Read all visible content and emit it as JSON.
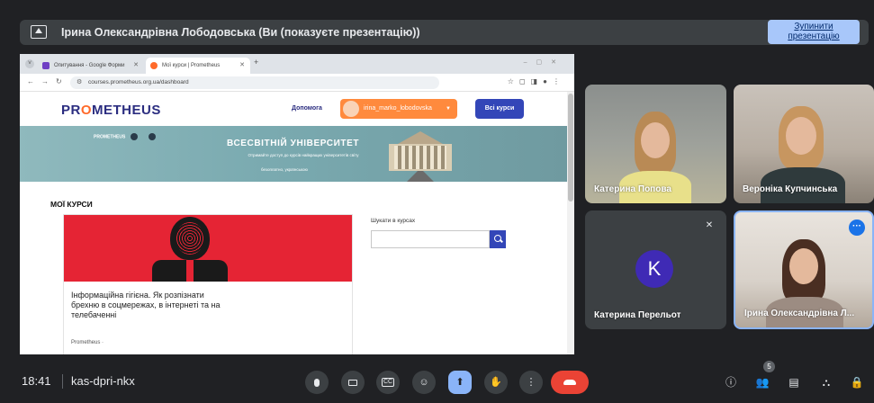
{
  "presenting": {
    "title": "Ірина Олександрівна Лободовська (Ви (показуєте презентацію))",
    "stop_label": "Зупинити презентацію"
  },
  "browser": {
    "tabs": [
      {
        "label": "Опитування - Google Форми"
      },
      {
        "label": "Мої курси | Prometheus"
      }
    ],
    "url": "courses.prometheus.org.ua/dashboard"
  },
  "site": {
    "logo_pre": "PR",
    "logo_o": "O",
    "logo_post": "METHEUS",
    "help": "Допомога",
    "user": "irina_marko_lobodovska",
    "all_courses": "Всі курси",
    "banner_logos": "PROMETHEUS",
    "banner_title": "ВСЕСВІТНІЙ УНІВЕРСИТЕТ",
    "banner_sub": "Отримайте доступ до курсів найкращих університетів світу",
    "banner_small": "безоплатно, українською",
    "my_courses": "МОЇ КУРСИ",
    "course_title": "Інформаційна гігієна. Як розпізнати брехню в соцмережах, в інтернеті та на телебаченні",
    "course_org": "Prometheus ·",
    "search_label": "Шукати в курсах",
    "search_placeholder": ""
  },
  "participants": [
    {
      "name": "Катерина Попова"
    },
    {
      "name": "Вероніка Купчинська"
    },
    {
      "name": "Катерина Перельот",
      "initial": "K"
    },
    {
      "name": "Ірина Олександрівна Л..."
    }
  ],
  "bottom": {
    "time": "18:41",
    "meeting_code": "kas-dpri-nkx",
    "participant_count": "5"
  },
  "colors": {
    "accent": "#8ab4f8",
    "end_call": "#ea4335",
    "avatar_k": "#3f2ab5",
    "prometheus_orange": "#ff6a2a",
    "prometheus_blue": "#3346b8"
  }
}
